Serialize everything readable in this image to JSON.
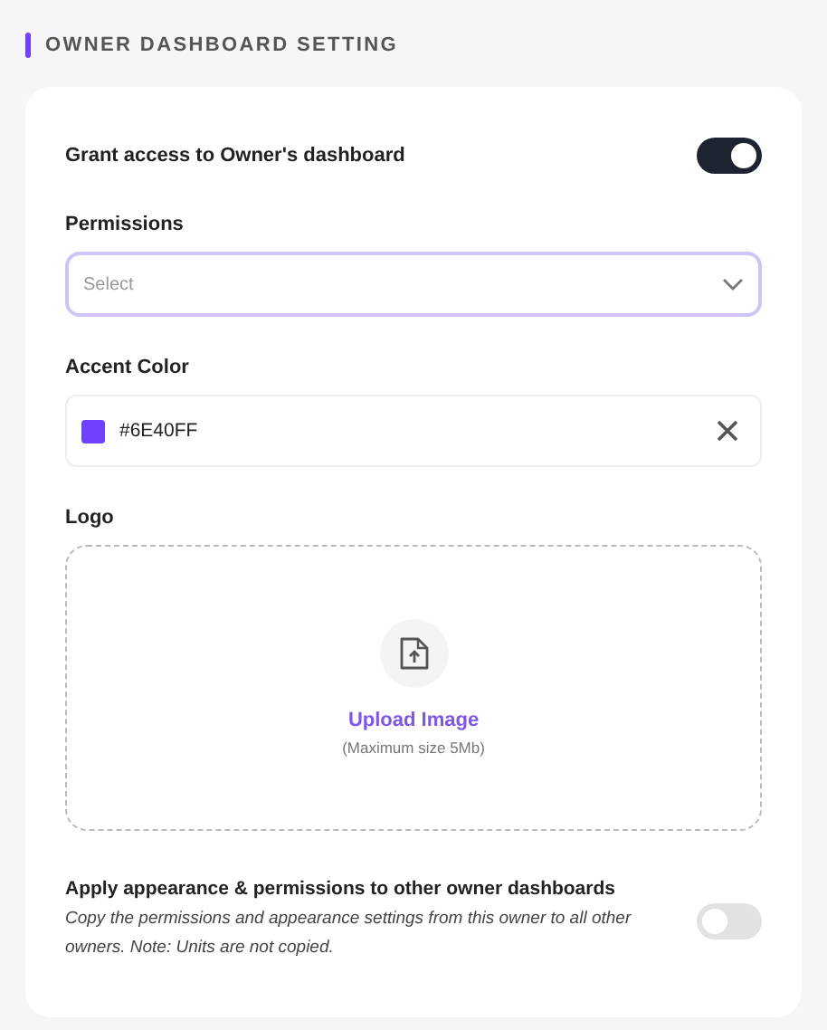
{
  "section_title": "OWNER DASHBOARD SETTING",
  "grant_access": {
    "label": "Grant access to Owner's dashboard",
    "on": true
  },
  "permissions": {
    "label": "Permissions",
    "placeholder": "Select"
  },
  "accent_color": {
    "label": "Accent Color",
    "value": "#6E40FF",
    "color": "#6e40ff"
  },
  "logo": {
    "label": "Logo",
    "upload_label": "Upload Image",
    "hint": "(Maximum size 5Mb)"
  },
  "apply_all": {
    "label": "Apply appearance & permissions to other owner dashboards",
    "description": "Copy the permissions and appearance settings from this owner to all other owners. Note: Units are not copied.",
    "on": false
  }
}
